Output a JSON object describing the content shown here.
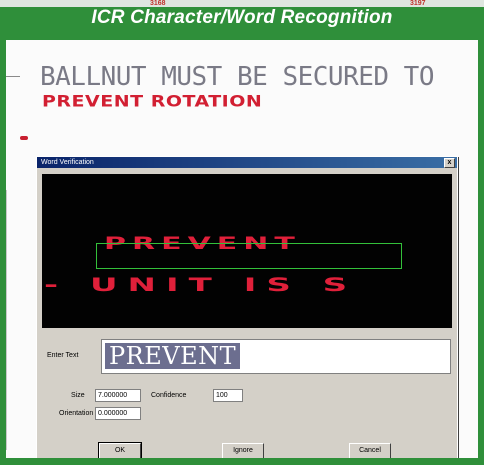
{
  "banner": {
    "title": "ICR Character/Word Recognition",
    "strip_left": "3168",
    "strip_right": "3197"
  },
  "document": {
    "printed_line": "BALLNUT MUST BE SECURED TO",
    "handwritten_line": "PREVENT ROTATION"
  },
  "dialog": {
    "title": "Word Verification",
    "close": "x",
    "preview_word": "PREVENT",
    "preview_line2": "- UNIT IS S",
    "enter_text_label": "Enter Text",
    "enter_text_value": "PREVENT",
    "size_label": "Size",
    "size_value": "7.000000",
    "confidence_label": "Confidence",
    "confidence_value": "100",
    "orientation_label": "Orientation",
    "orientation_value": "0.000000",
    "ok_label": "OK",
    "ignore_label": "Ignore",
    "cancel_label": "Cancel"
  },
  "colors": {
    "frame_green": "#2f8f3a",
    "ink_red": "#d21f32",
    "selection": "#6c6e8f",
    "bbox_green": "#33c03a"
  }
}
